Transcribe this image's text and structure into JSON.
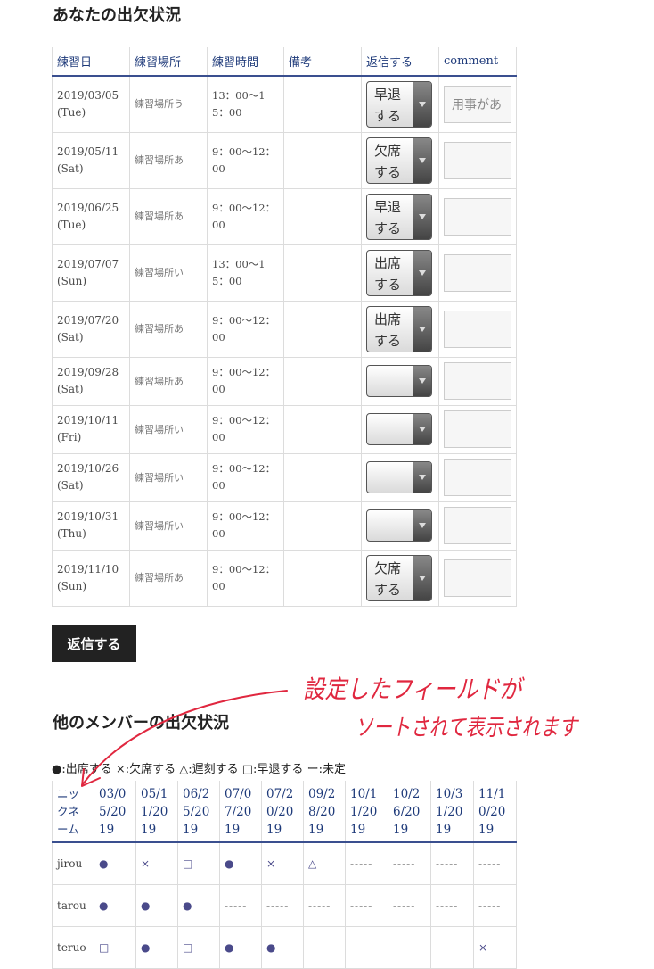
{
  "titles": {
    "mine": "あなたの出欠状況",
    "others": "他のメンバーの出欠状況"
  },
  "attendance_table": {
    "headers": [
      "練習日",
      "練習場所",
      "練習時間",
      "備考",
      "返信する",
      "comment"
    ],
    "rows": [
      {
        "date": "2019/03/05(Tue)",
        "place": "練習場所う",
        "time": "13：00〜15：00",
        "note": "",
        "reply": "早退する",
        "comment": "用事があ"
      },
      {
        "date": "2019/05/11(Sat)",
        "place": "練習場所あ",
        "time": "9：00〜12：00",
        "note": "",
        "reply": "欠席する",
        "comment": ""
      },
      {
        "date": "2019/06/25(Tue)",
        "place": "練習場所あ",
        "time": "9：00〜12：00",
        "note": "",
        "reply": "早退する",
        "comment": ""
      },
      {
        "date": "2019/07/07(Sun)",
        "place": "練習場所い",
        "time": "13：00〜15：00",
        "note": "",
        "reply": "出席する",
        "comment": ""
      },
      {
        "date": "2019/07/20(Sat)",
        "place": "練習場所あ",
        "time": "9：00〜12：00",
        "note": "",
        "reply": "出席する",
        "comment": ""
      },
      {
        "date": "2019/09/28(Sat)",
        "place": "練習場所あ",
        "time": "9：00〜12：00",
        "note": "",
        "reply": "",
        "comment": ""
      },
      {
        "date": "2019/10/11(Fri)",
        "place": "練習場所い",
        "time": "9：00〜12：00",
        "note": "",
        "reply": "",
        "comment": ""
      },
      {
        "date": "2019/10/26(Sat)",
        "place": "練習場所い",
        "time": "9：00〜12：00",
        "note": "",
        "reply": "",
        "comment": ""
      },
      {
        "date": "2019/10/31(Thu)",
        "place": "練習場所い",
        "time": "9：00〜12：00",
        "note": "",
        "reply": "",
        "comment": ""
      },
      {
        "date": "2019/11/10(Sun)",
        "place": "練習場所あ",
        "time": "9：00〜12：00",
        "note": "",
        "reply": "欠席する",
        "comment": ""
      }
    ]
  },
  "reply_button_label": "返信する",
  "legend": "●:出席する ×:欠席する △:遅刻する □:早退する ー:未定",
  "members_table": {
    "headers": [
      "ニックネーム",
      "03/05/2019",
      "05/11/2019",
      "06/25/2019",
      "07/07/2019",
      "07/20/2019",
      "09/28/2019",
      "10/11/2019",
      "10/26/2019",
      "10/31/2019",
      "11/10/2019"
    ],
    "rows": [
      {
        "name": "jirou",
        "cells": [
          "●",
          "×",
          "□",
          "●",
          "×",
          "△",
          "-----",
          "-----",
          "-----",
          "-----"
        ]
      },
      {
        "name": "tarou",
        "cells": [
          "●",
          "●",
          "●",
          "-----",
          "-----",
          "-----",
          "-----",
          "-----",
          "-----",
          "-----"
        ]
      },
      {
        "name": "teruo",
        "cells": [
          "□",
          "●",
          "□",
          "●",
          "●",
          "-----",
          "-----",
          "-----",
          "-----",
          "×"
        ]
      }
    ]
  },
  "annotation": {
    "line1": "設定したフィールドが",
    "line2": "ソートされて表示されます",
    "color": "#e0273f"
  }
}
